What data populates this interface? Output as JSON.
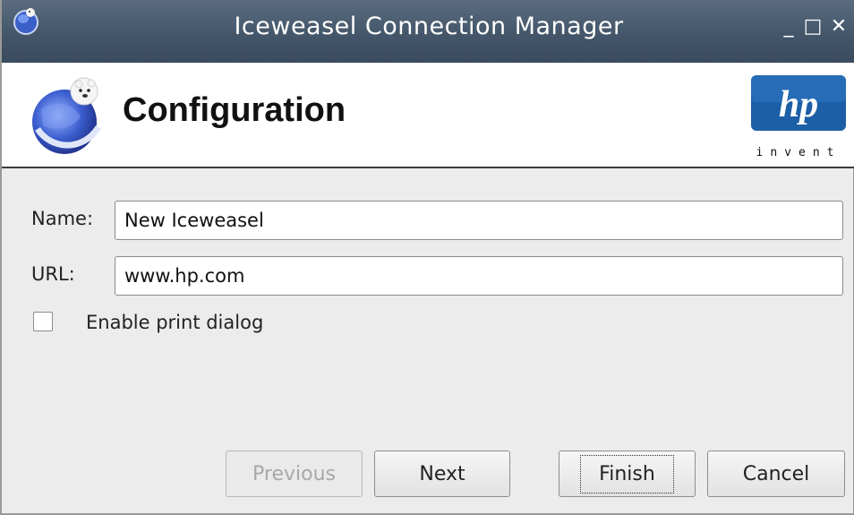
{
  "window": {
    "title": "Iceweasel Connection Manager",
    "controls": {
      "minimize": "_",
      "maximize": "□",
      "close": "✕"
    }
  },
  "header": {
    "heading": "Configuration",
    "app_logo_icon": "iceweasel-globe-icon",
    "brand_logo": {
      "mark": "hp",
      "tagline": "invent"
    }
  },
  "form": {
    "name_label": "Name:",
    "name_value": "New Iceweasel",
    "url_label": "URL:",
    "url_value": "www.hp.com",
    "print_dialog_label": "Enable print dialog",
    "print_dialog_checked": false
  },
  "buttons": {
    "previous": "Previous",
    "next": "Next",
    "finish": "Finish",
    "cancel": "Cancel"
  },
  "colors": {
    "titlebar": "#44566a",
    "hp_blue": "#1d5fa6"
  }
}
